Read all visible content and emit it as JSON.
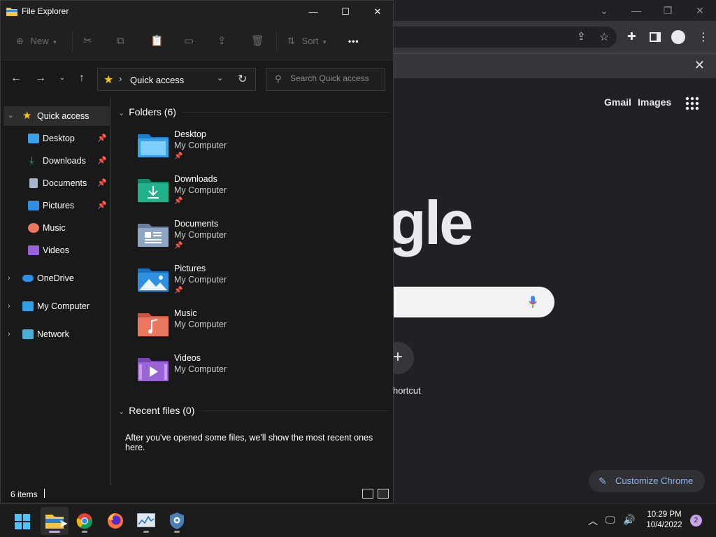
{
  "chrome": {
    "top_links": [
      "Gmail",
      "Images"
    ],
    "logo_partial": "gle",
    "add_shortcut_label": "hortcut",
    "customize_label": "Customize Chrome"
  },
  "explorer": {
    "title": "File Explorer",
    "ribbon": {
      "new_label": "New",
      "sort_label": "Sort",
      "more_label": "•••"
    },
    "address": {
      "location": "Quick access",
      "search_placeholder": "Search Quick access"
    },
    "nav": {
      "quick_access": "Quick access",
      "pinned": [
        "Desktop",
        "Downloads",
        "Documents",
        "Pictures"
      ],
      "unpinned": [
        "Music",
        "Videos"
      ],
      "onedrive": "OneDrive",
      "my_computer": "My Computer",
      "network": "Network"
    },
    "folders_header": "Folders (6)",
    "folders": [
      {
        "name": "Desktop",
        "location": "My Computer",
        "pinned": true,
        "color": "#3aa0e8"
      },
      {
        "name": "Downloads",
        "location": "My Computer",
        "pinned": true,
        "color": "#21b28a"
      },
      {
        "name": "Documents",
        "location": "My Computer",
        "pinned": true,
        "color": "#8fa5c4"
      },
      {
        "name": "Pictures",
        "location": "My Computer",
        "pinned": true,
        "color": "#2f8fe0"
      },
      {
        "name": "Music",
        "location": "My Computer",
        "pinned": false,
        "color": "#e9785f"
      },
      {
        "name": "Videos",
        "location": "My Computer",
        "pinned": false,
        "color": "#9a64d8"
      }
    ],
    "recent_header": "Recent files (0)",
    "recent_message": "After you've opened some files, we'll show the most recent ones here.",
    "status": "6 items"
  },
  "taskbar": {
    "time": "10:29 PM",
    "date": "10/4/2022",
    "notification_count": "2"
  }
}
